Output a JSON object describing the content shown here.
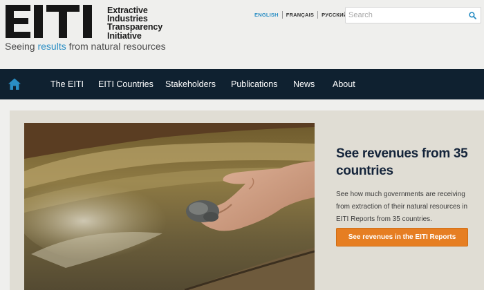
{
  "header": {
    "logo_mark": "EITI",
    "logo_lines": [
      "Extractive",
      "Industries",
      "Transparency",
      "Initiative"
    ],
    "tagline_before": "Seeing ",
    "tagline_accent": "results",
    "tagline_after": " from natural resources",
    "languages": [
      {
        "label": "English",
        "active": true
      },
      {
        "label": "Français",
        "active": false
      },
      {
        "label": "Русский",
        "active": false
      }
    ],
    "search": {
      "placeholder": "Search",
      "value": ""
    }
  },
  "nav": {
    "home_icon": "home-icon",
    "items": [
      "The EITI",
      "EITI Countries",
      "Stakeholders",
      "Publications",
      "News",
      "About"
    ]
  },
  "hero": {
    "image": "hand holding ore over muddy water",
    "title": "See revenues from 35 countries",
    "description": "See how much governments are receiving from extraction of their natural resources in EITI Reports from 35 countries.",
    "cta_label": "See revenues in the EITI Reports"
  },
  "colors": {
    "accent_blue": "#2a8ec4",
    "nav_background": "#0f2130",
    "cta_orange": "#e67e22",
    "hero_panel": "#e0ddd4",
    "page_background": "#efefed"
  }
}
